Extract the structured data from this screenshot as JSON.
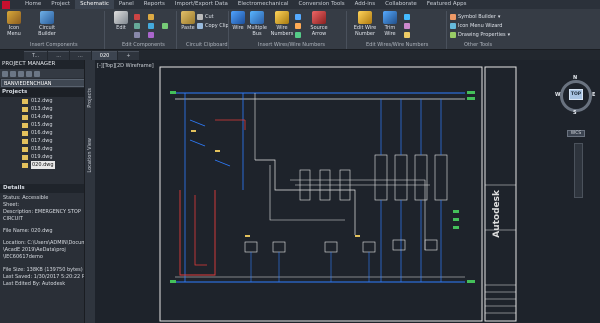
{
  "ribbon_tabs": [
    "Home",
    "Project",
    "Schematic",
    "Panel",
    "Reports",
    "Import/Export Data",
    "Electromechanical",
    "Conversion Tools",
    "Add-ins",
    "Collaborate",
    "Featured Apps"
  ],
  "active_tab": "Schematic",
  "ribbon": {
    "icon_menu": "Icon Menu",
    "circuit_builder": "Circuit Builder",
    "edit": "Edit",
    "cut": "Cut",
    "copy_clip": "Copy Clip",
    "paste": "Paste",
    "wire": "Wire",
    "multiple_bus": "Multiple Bus",
    "wire_numbers": "Wire Numbers",
    "source_arrow": "Source Arrow",
    "edit_wire_number": "Edit Wire Number",
    "trim_wire": "Trim Wire",
    "symbol_builder": "Symbol Builder",
    "icon_menu_wizard": "Icon Menu Wizard",
    "drawing_properties": "Drawing Properties",
    "groups": {
      "insert_components": "Insert Components",
      "edit_components": "Edit Components",
      "circuit_clipboard": "Circuit Clipboard",
      "insert_wires": "Insert Wires/Wire Numbers",
      "edit_wires": "Edit Wires/Wire Numbers",
      "other_tools": "Other Tools"
    }
  },
  "doc_tabs": [
    "T...",
    "...",
    "...",
    "020"
  ],
  "project_manager": {
    "title": "PROJECT MANAGER",
    "selected_project": "BANVIEDENCHUAN",
    "projects_header": "Projects",
    "files": [
      "012.dwg",
      "013.dwg",
      "014.dwg",
      "015.dwg",
      "016.dwg",
      "017.dwg",
      "018.dwg",
      "019.dwg",
      "020.dwg"
    ],
    "selected_file": "020.dwg",
    "side_labels": [
      "Projects",
      "Location View"
    ]
  },
  "details": {
    "header": "Details",
    "lines": [
      "Status: Accessible",
      "Sheet:",
      "Description: EMERGENCY STOP",
      "CIRCUIT",
      "",
      "File Name: 020.dwg",
      "",
      "Location: C:\\Users\\ADMIN\\Documents",
      "\\AcadE 2019\\AeData\\proj",
      "\\IEC60617demo",
      "",
      "File Size: 138KB (139750 bytes)",
      "Last Saved: 1/30/2017 5:20:22 PM",
      "Last Edited By: Autodesk"
    ]
  },
  "viewport_label": "[-][Top][2D Wireframe]",
  "viewcube": {
    "top": "TOP",
    "n": "N",
    "s": "S",
    "e": "E",
    "w": "W",
    "wcs": "WCS"
  },
  "title_block": "Autodesk",
  "colors": {
    "ribbon": "#363c45",
    "canvas": "#1e232b",
    "wire_blue": "#2f7dff",
    "wire_red": "#e23b3b",
    "line_white": "#e6e6e6",
    "accent_green": "#44c05a",
    "folder_yellow": "#e3c15c"
  }
}
